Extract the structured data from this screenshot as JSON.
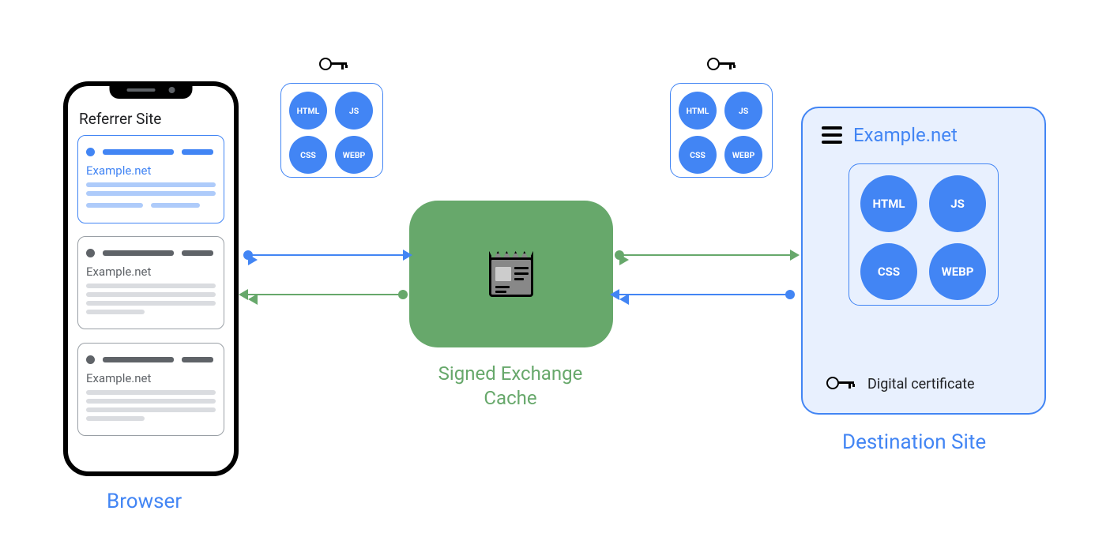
{
  "browser": {
    "label": "Browser",
    "referrer_title": "Referrer Site",
    "cards": [
      {
        "title": "Example.net"
      },
      {
        "title": "Example.net"
      },
      {
        "title": "Example.net"
      }
    ]
  },
  "bundle_left": {
    "html": "HTML",
    "js": "JS",
    "css": "CSS",
    "webp": "WEBP"
  },
  "bundle_right": {
    "html": "HTML",
    "js": "JS",
    "css": "CSS",
    "webp": "WEBP"
  },
  "sxg": {
    "label": "Signed Exchange Cache"
  },
  "destination": {
    "title": "Example.net",
    "bundle": {
      "html": "HTML",
      "js": "JS",
      "css": "CSS",
      "webp": "WEBP"
    },
    "certificate_label": "Digital certificate",
    "label": "Destination Site"
  },
  "colors": {
    "blue": "#4285f4",
    "green": "#67a86b",
    "gray": "#5f6368",
    "lightblue_bg": "#e8f0fe"
  }
}
